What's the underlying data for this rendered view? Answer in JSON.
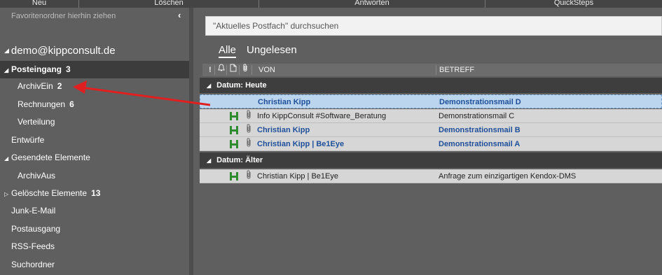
{
  "ribbon": {
    "groups": [
      "Neu",
      "Löschen",
      "Antworten",
      "QuickSteps"
    ]
  },
  "sidebar": {
    "favorites_hint": "Favoritenordner hierhin ziehen",
    "account": "demo@kippconsult.de",
    "folders": [
      {
        "label": "Posteingang",
        "count": "3",
        "selected": true,
        "expanded": true
      },
      {
        "label": "ArchivEin",
        "count": "2"
      },
      {
        "label": "Rechnungen",
        "count": "6"
      },
      {
        "label": "Verteilung",
        "count": ""
      },
      {
        "label": "Entwürfe",
        "count": ""
      },
      {
        "label": "Gesendete Elemente",
        "count": "",
        "expanded": true
      },
      {
        "label": "ArchivAus",
        "count": ""
      },
      {
        "label": "Gelöschte Elemente",
        "count": "13",
        "collapsed": true
      },
      {
        "label": "Junk-E-Mail",
        "count": ""
      },
      {
        "label": "Postausgang",
        "count": ""
      },
      {
        "label": "RSS-Feeds",
        "count": ""
      },
      {
        "label": "Suchordner",
        "count": ""
      }
    ]
  },
  "main": {
    "search_placeholder": "\"Aktuelles Postfach\" durchsuchen",
    "tabs": [
      "Alle",
      "Ungelesen"
    ],
    "columns": {
      "importance": "!",
      "from": "VON",
      "subject": "BETREFF"
    },
    "groups": [
      {
        "label": "Datum: Heute",
        "rows": [
          {
            "from": "Christian Kipp",
            "subject": "Demonstrationsmail D",
            "unread": true,
            "selected": true
          },
          {
            "from": "Info KippConsult #Software_Beratung",
            "subject": "Demonstrationsmail C",
            "unread": false
          },
          {
            "from": "Christian Kipp",
            "subject": "Demonstrationsmail B",
            "unread": true
          },
          {
            "from": "Christian Kipp | Be1Eye",
            "subject": "Demonstrationsmail A",
            "unread": true
          }
        ]
      },
      {
        "label": "Datum: Älter",
        "rows": [
          {
            "from": "Christian Kipp | Be1Eye",
            "subject": "Anfrage zum einzigartigen Kendox-DMS",
            "unread": false
          }
        ]
      }
    ]
  },
  "colors": {
    "accent_unread": "#1e4f9a",
    "selection": "#bcd5ee",
    "annotation_arrow": "#e02020",
    "archive_icon": "#2e8b2e"
  }
}
